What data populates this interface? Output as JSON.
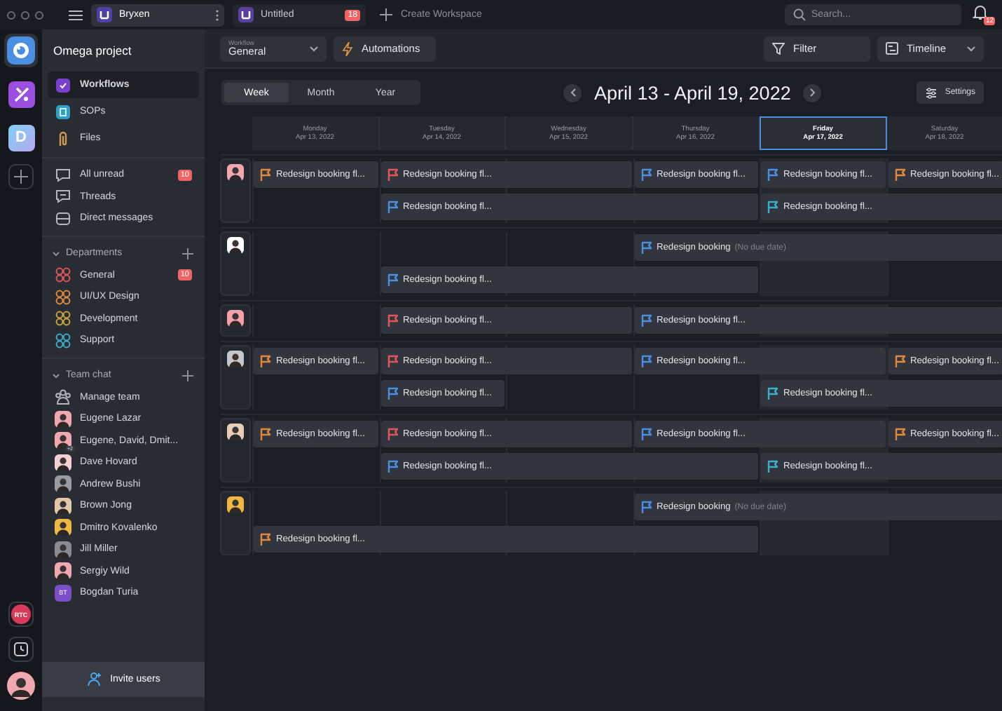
{
  "top_bar": {
    "workspaces": [
      {
        "name": "Bryxen",
        "selected": true
      },
      {
        "name": "Untitled",
        "selected": false,
        "badge": "18"
      }
    ],
    "create": "Create Workspace",
    "search": {
      "placeholder": "Search..."
    },
    "notifications_badge": "12"
  },
  "rail": {
    "apps": [
      {
        "kind": "logo",
        "selected": true
      },
      {
        "kind": "tools",
        "selected": false
      },
      {
        "kind": "letter",
        "letter": "D",
        "selected": false
      }
    ],
    "status": "RTC"
  },
  "sidebar": {
    "title": "Omega project",
    "nav": [
      {
        "label": "Workflows",
        "kind": "clipboard",
        "selected": true
      },
      {
        "label": "SOPs",
        "kind": "book",
        "selected": false
      },
      {
        "label": "Files",
        "kind": "clip",
        "selected": false
      }
    ],
    "inbox": [
      {
        "label": "All unread",
        "kind": "chat",
        "badge": "10"
      },
      {
        "label": "Threads",
        "kind": "thread"
      },
      {
        "label": "Direct messages",
        "kind": "inbox"
      }
    ],
    "departments": {
      "title": "Departments",
      "expanded": true,
      "items": [
        {
          "label": "General",
          "color": "#e0575b",
          "badge": "10"
        },
        {
          "label": "UI/UX Design",
          "color": "#e08a3c"
        },
        {
          "label": "Development",
          "color": "#c9a440"
        },
        {
          "label": "Support",
          "color": "#3ab0c8"
        }
      ]
    },
    "team_chat": {
      "title": "Team chat",
      "expanded": true,
      "items": [
        {
          "label": "Manage team",
          "kind": "team"
        },
        {
          "label": "Eugene Lazar",
          "kind": "person"
        },
        {
          "label": "Eugene, David, Dmit...",
          "kind": "group",
          "count": "+2"
        },
        {
          "label": "Dave Hovard",
          "kind": "person"
        },
        {
          "label": "Andrew Bushi",
          "kind": "person"
        },
        {
          "label": "Brown Jong",
          "kind": "person"
        },
        {
          "label": "Dmitro Kovalenko",
          "kind": "person"
        },
        {
          "label": "Jill Miller",
          "kind": "person"
        },
        {
          "label": "Sergiy Wild",
          "kind": "person"
        },
        {
          "label": "Bogdan Turia",
          "kind": "initials",
          "initials": "BT"
        }
      ]
    },
    "invite": "Invite users"
  },
  "toolbar": {
    "workflow": {
      "label": "Workflow",
      "value": "General"
    },
    "automations": "Automations",
    "filter": "Filter",
    "view": "Timeline"
  },
  "calendar": {
    "ranges": [
      {
        "label": "Week",
        "selected": true
      },
      {
        "label": "Month",
        "selected": false
      },
      {
        "label": "Year",
        "selected": false
      }
    ],
    "title": "April 13 - April 19, 2022",
    "settings": "Settings",
    "days": [
      {
        "name": "Monday",
        "date": "Apr 13, 2022",
        "selected": false
      },
      {
        "name": "Tuesday",
        "date": "Apr 14, 2022",
        "selected": false
      },
      {
        "name": "Wednesday",
        "date": "Apr 15, 2022",
        "selected": false
      },
      {
        "name": "Thursday",
        "date": "Apr 16, 2022",
        "selected": false
      },
      {
        "name": "Friday",
        "date": "Apr 17, 2022",
        "selected": true
      },
      {
        "name": "Saturday",
        "date": "Apr 18, 2022",
        "selected": false
      }
    ],
    "people": [
      {
        "lanes": [
          [
            {
              "kind": "task",
              "title": "Redesign booking fl...",
              "color": "#e08a3c"
            },
            {
              "kind": "task",
              "title": "Redesign booking fl...",
              "color": "#e0575b"
            },
            {
              "kind": "continued"
            },
            {
              "kind": "task",
              "title": "Redesign booking fl...",
              "color": "#4a8fe0"
            },
            {
              "kind": "task",
              "title": "Redesign booking fl...",
              "color": "#4a8fe0"
            },
            {
              "kind": "task",
              "title": "Redesign booking fl...",
              "color": "#e08a3c"
            }
          ],
          [
            {
              "kind": "empty"
            },
            {
              "kind": "task",
              "title": "Redesign booking fl...",
              "color": "#4a8fe0"
            },
            {
              "kind": "continued"
            },
            {
              "kind": "continued"
            },
            {
              "kind": "task",
              "title": "Redesign booking fl...",
              "color": "#3ab0c8"
            },
            {
              "kind": "continued"
            }
          ]
        ]
      },
      {
        "lanes": [
          [
            {
              "kind": "empty"
            },
            {
              "kind": "empty"
            },
            {
              "kind": "empty"
            },
            {
              "kind": "task",
              "title": "Redesign booking",
              "note": "(No due date)",
              "color": "#4a8fe0"
            },
            {
              "kind": "continued"
            },
            {
              "kind": "continued"
            }
          ],
          [
            {
              "kind": "empty"
            },
            {
              "kind": "task",
              "title": "Redesign booking fl...",
              "color": "#4a8fe0"
            },
            {
              "kind": "continued"
            },
            {
              "kind": "continued"
            },
            {
              "kind": "empty"
            },
            {
              "kind": "empty"
            }
          ]
        ]
      },
      {
        "lanes": [
          [
            {
              "kind": "empty"
            },
            {
              "kind": "task",
              "title": "Redesign booking fl...",
              "color": "#e0575b"
            },
            {
              "kind": "continued"
            },
            {
              "kind": "task",
              "title": "Redesign booking fl...",
              "color": "#4a8fe0"
            },
            {
              "kind": "continued"
            },
            {
              "kind": "continued"
            }
          ]
        ]
      },
      {
        "lanes": [
          [
            {
              "kind": "task",
              "title": "Redesign booking fl...",
              "color": "#e08a3c"
            },
            {
              "kind": "task",
              "title": "Redesign booking fl...",
              "color": "#e0575b"
            },
            {
              "kind": "continued"
            },
            {
              "kind": "task",
              "title": "Redesign booking fl...",
              "color": "#4a8fe0"
            },
            {
              "kind": "continued"
            },
            {
              "kind": "task",
              "title": "Redesign booking fl...",
              "color": "#e08a3c"
            }
          ],
          [
            {
              "kind": "empty"
            },
            {
              "kind": "task",
              "title": "Redesign booking fl...",
              "color": "#4a8fe0"
            },
            {
              "kind": "empty"
            },
            {
              "kind": "empty"
            },
            {
              "kind": "task",
              "title": "Redesign booking fl...",
              "color": "#3ab0c8"
            },
            {
              "kind": "continued"
            }
          ]
        ]
      },
      {
        "lanes": [
          [
            {
              "kind": "task",
              "title": "Redesign booking fl...",
              "color": "#e08a3c"
            },
            {
              "kind": "task",
              "title": "Redesign booking fl...",
              "color": "#e0575b"
            },
            {
              "kind": "continued"
            },
            {
              "kind": "task",
              "title": "Redesign booking fl...",
              "color": "#4a8fe0"
            },
            {
              "kind": "continued"
            },
            {
              "kind": "task",
              "title": "Redesign booking fl...",
              "color": "#e08a3c"
            }
          ],
          [
            {
              "kind": "empty"
            },
            {
              "kind": "task",
              "title": "Redesign booking fl...",
              "color": "#4a8fe0"
            },
            {
              "kind": "continued"
            },
            {
              "kind": "continued"
            },
            {
              "kind": "task",
              "title": "Redesign booking fl...",
              "color": "#3ab0c8"
            },
            {
              "kind": "continued"
            }
          ]
        ]
      },
      {
        "lanes": [
          [
            {
              "kind": "empty"
            },
            {
              "kind": "empty"
            },
            {
              "kind": "empty"
            },
            {
              "kind": "task",
              "title": "Redesign booking",
              "note": "(No due date)",
              "color": "#4a8fe0"
            },
            {
              "kind": "continued"
            },
            {
              "kind": "continued"
            }
          ],
          [
            {
              "kind": "task",
              "title": "Redesign booking fl...",
              "color": "#e08a3c"
            },
            {
              "kind": "continued"
            },
            {
              "kind": "continued"
            },
            {
              "kind": "continued"
            },
            {
              "kind": "empty"
            },
            {
              "kind": "empty"
            }
          ]
        ]
      }
    ]
  }
}
